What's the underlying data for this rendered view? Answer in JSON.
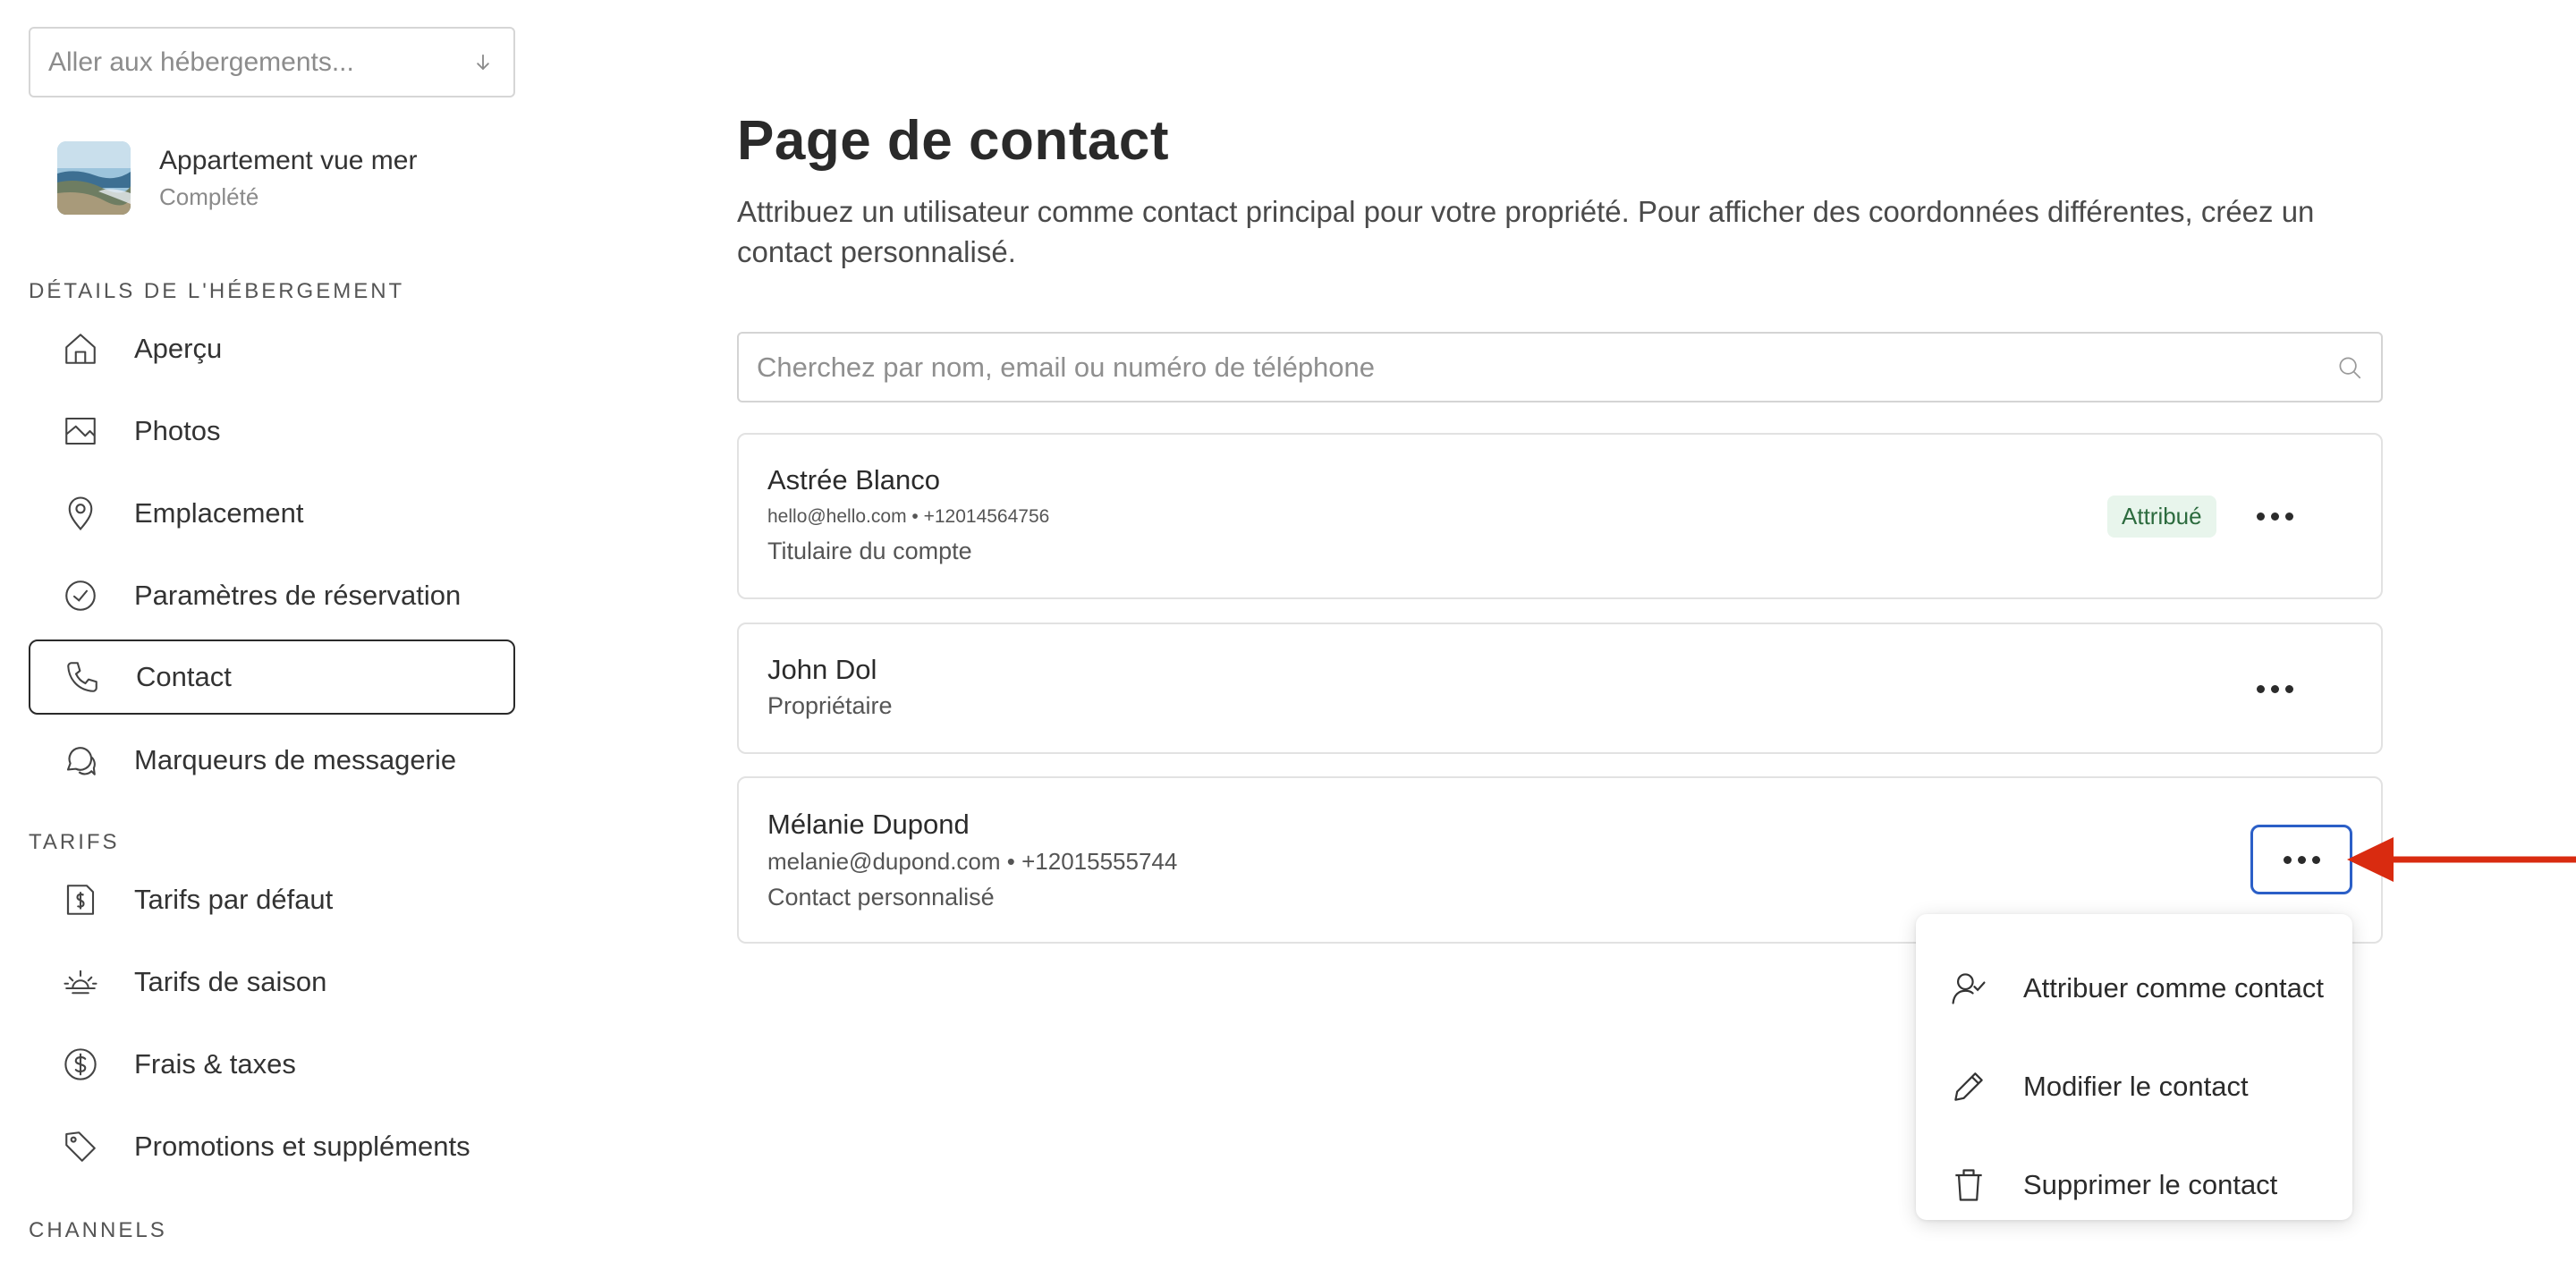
{
  "sidebar": {
    "goto_placeholder": "Aller aux hébergements...",
    "property": {
      "name": "Appartement vue mer",
      "status": "Complété"
    },
    "sections": [
      {
        "title": "DÉTAILS DE L'HÉBERGEMENT"
      },
      {
        "title": "TARIFS"
      },
      {
        "title": "CHANNELS"
      }
    ],
    "items": [
      {
        "label": "Aperçu",
        "icon": "home-icon"
      },
      {
        "label": "Photos",
        "icon": "image-icon"
      },
      {
        "label": "Emplacement",
        "icon": "map-pin-icon"
      },
      {
        "label": "Paramètres de réservation",
        "icon": "check-circle-icon"
      },
      {
        "label": "Contact",
        "icon": "phone-icon",
        "active": true
      },
      {
        "label": "Marqueurs de messagerie",
        "icon": "chat-icon"
      },
      {
        "label": "Tarifs par défaut",
        "icon": "price-tag-file-icon"
      },
      {
        "label": "Tarifs de saison",
        "icon": "sun-icon"
      },
      {
        "label": "Frais & taxes",
        "icon": "dollar-circle-icon"
      },
      {
        "label": "Promotions et suppléments",
        "icon": "tag-icon"
      }
    ]
  },
  "main": {
    "title": "Page de contact",
    "description": "Attribuez un utilisateur comme contact principal pour votre propriété. Pour afficher des coordonnées différentes, créez un contact personnalisé.",
    "search_placeholder": "Cherchez par nom, email ou numéro de téléphone",
    "contacts": [
      {
        "name": "Astrée Blanco",
        "meta": "hello@hello.com • +12014564756",
        "role": "Titulaire du compte",
        "badge": "Attribué"
      },
      {
        "name": "John Dol",
        "role": "Propriétaire"
      },
      {
        "name": "Mélanie Dupond",
        "meta": "melanie@dupond.com • +12015555744",
        "role": "Contact personnalisé"
      }
    ]
  },
  "menu": {
    "items": [
      {
        "label": "Attribuer comme contact",
        "icon": "user-check-icon"
      },
      {
        "label": "Modifier le contact",
        "icon": "pencil-icon"
      },
      {
        "label": "Supprimer le contact",
        "icon": "trash-icon"
      }
    ]
  },
  "colors": {
    "focus_ring": "#2b5fc7",
    "badge_bg": "#e8f5ec",
    "badge_text": "#2c6b3e",
    "annotation_arrow": "#d92b10"
  }
}
